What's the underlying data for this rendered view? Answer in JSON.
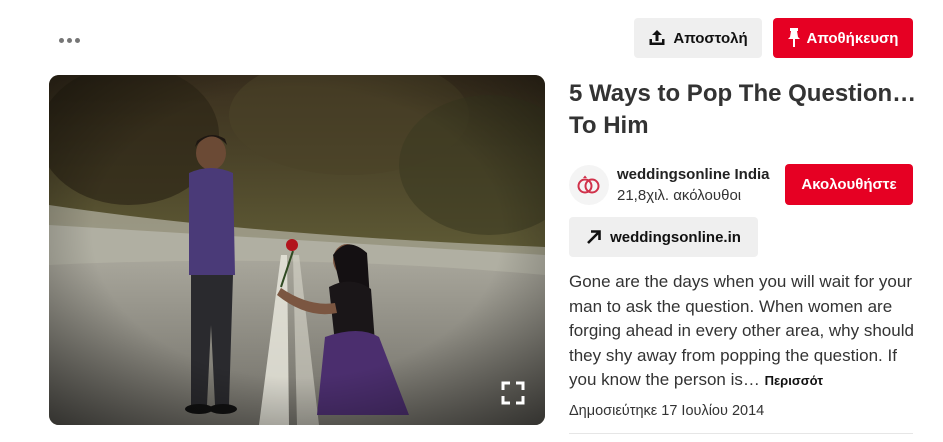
{
  "header": {
    "more_icon": "ellipsis-icon",
    "share_label": "Αποστολή",
    "share_icon": "upload-icon",
    "save_label": "Αποθήκευση",
    "save_icon": "pushpin-icon",
    "brand_color": "#e60023"
  },
  "pin": {
    "image_icon": "expand-icon",
    "title": "5 Ways to Pop The Question… To Him",
    "creator": {
      "name": "weddingsonline India",
      "followers": "21,8χιλ. ακόλουθοι",
      "avatar_icon": "rings-icon",
      "follow_label": "Ακολουθήστε"
    },
    "source": {
      "label": "weddingsonline.in",
      "icon": "arrow-up-right-icon"
    },
    "description": "Gone are the days when you will wait for your man to ask the question. When women are forging ahead in every other area, why should they shy away from popping the question. If you know the person is…",
    "more_label": "Περισσότ",
    "published": "Δημοσιεύτηκε 17 Ιουλίου 2014"
  }
}
